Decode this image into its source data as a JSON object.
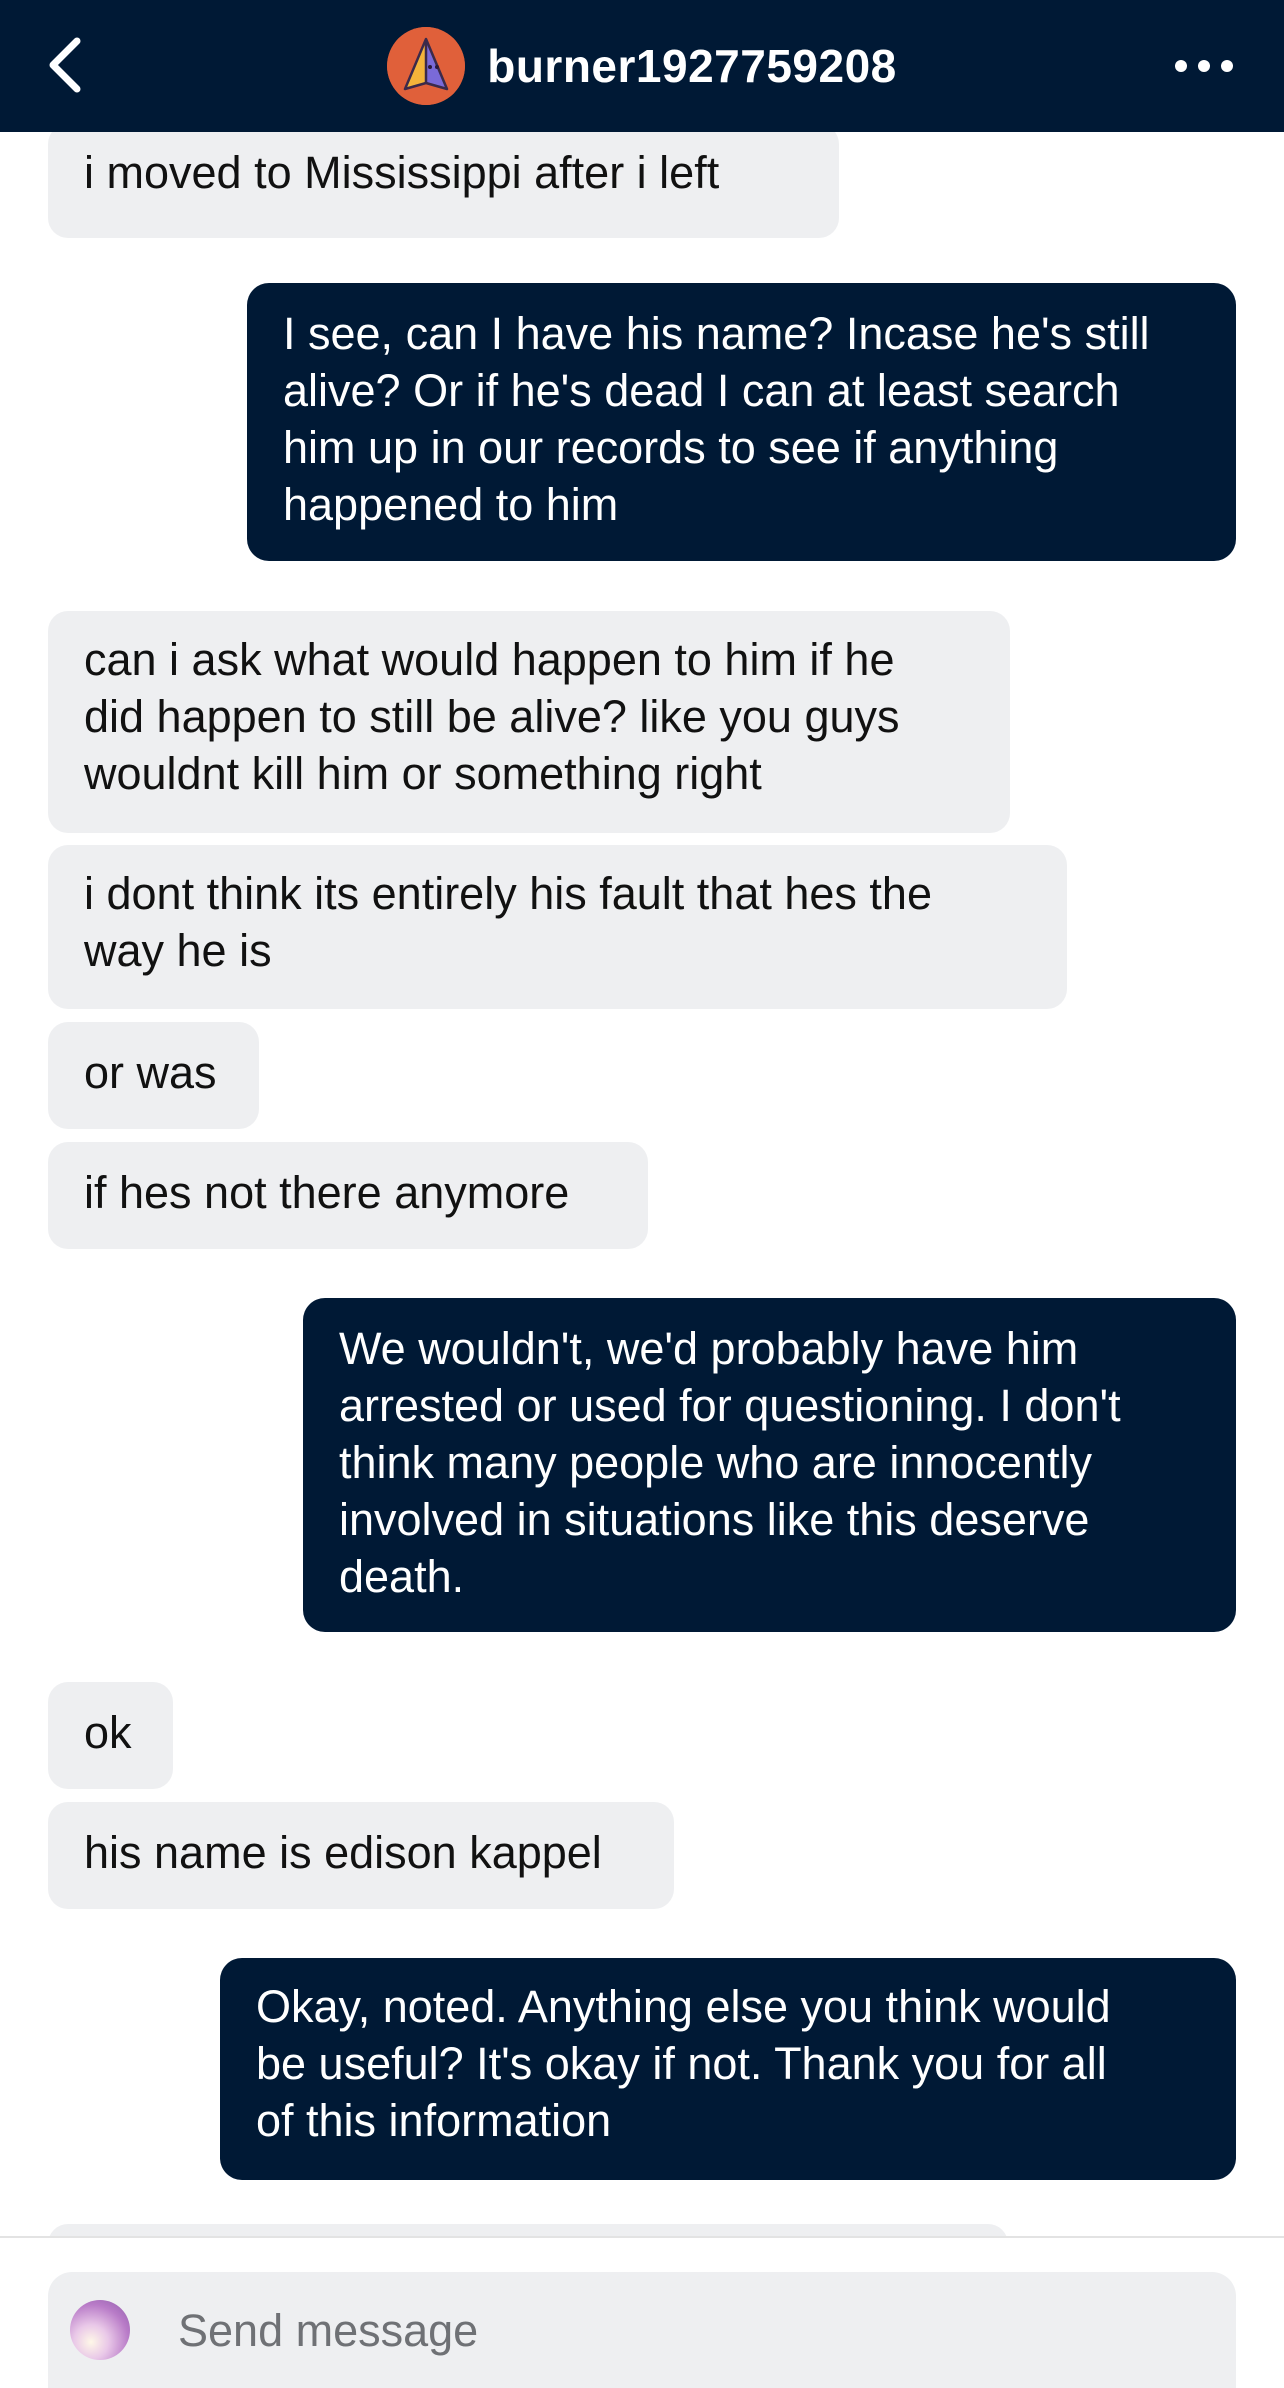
{
  "header": {
    "username": "burner1927759208",
    "back_icon": "chevron-left-icon",
    "more_icon": "more-horizontal-icon"
  },
  "messages": [
    {
      "side": "in",
      "text": "i moved to Mississippi after i left"
    },
    {
      "side": "out",
      "text": "I see, can I have his name? Incase he's still\nalive? Or if he's dead I can at least search\nhim up in our records to see if anything\nhappened to him"
    },
    {
      "side": "in",
      "text": "can i ask what would happen to him if he\ndid happen to still be alive? like you guys\nwouldnt kill him or something right"
    },
    {
      "side": "in",
      "text": "i dont think its entirely his fault that hes the\nway he is"
    },
    {
      "side": "in",
      "text": "or was"
    },
    {
      "side": "in",
      "text": "if hes not there anymore"
    },
    {
      "side": "out",
      "text": "We wouldn't, we'd probably have him\narrested or used for questioning. I don't\nthink many people who are innocently\ninvolved in situations like this deserve\ndeath."
    },
    {
      "side": "in",
      "text": "ok"
    },
    {
      "side": "in",
      "text": "his name is edison kappel"
    },
    {
      "side": "out",
      "text": "Okay, noted. Anything else you think would\nbe useful? It's okay if not. Thank you for all\nof this information"
    }
  ],
  "composer": {
    "placeholder": "Send message"
  },
  "colors": {
    "header_bg": "#001935",
    "outgoing_bg": "#001935",
    "incoming_bg": "#eeeff1"
  }
}
